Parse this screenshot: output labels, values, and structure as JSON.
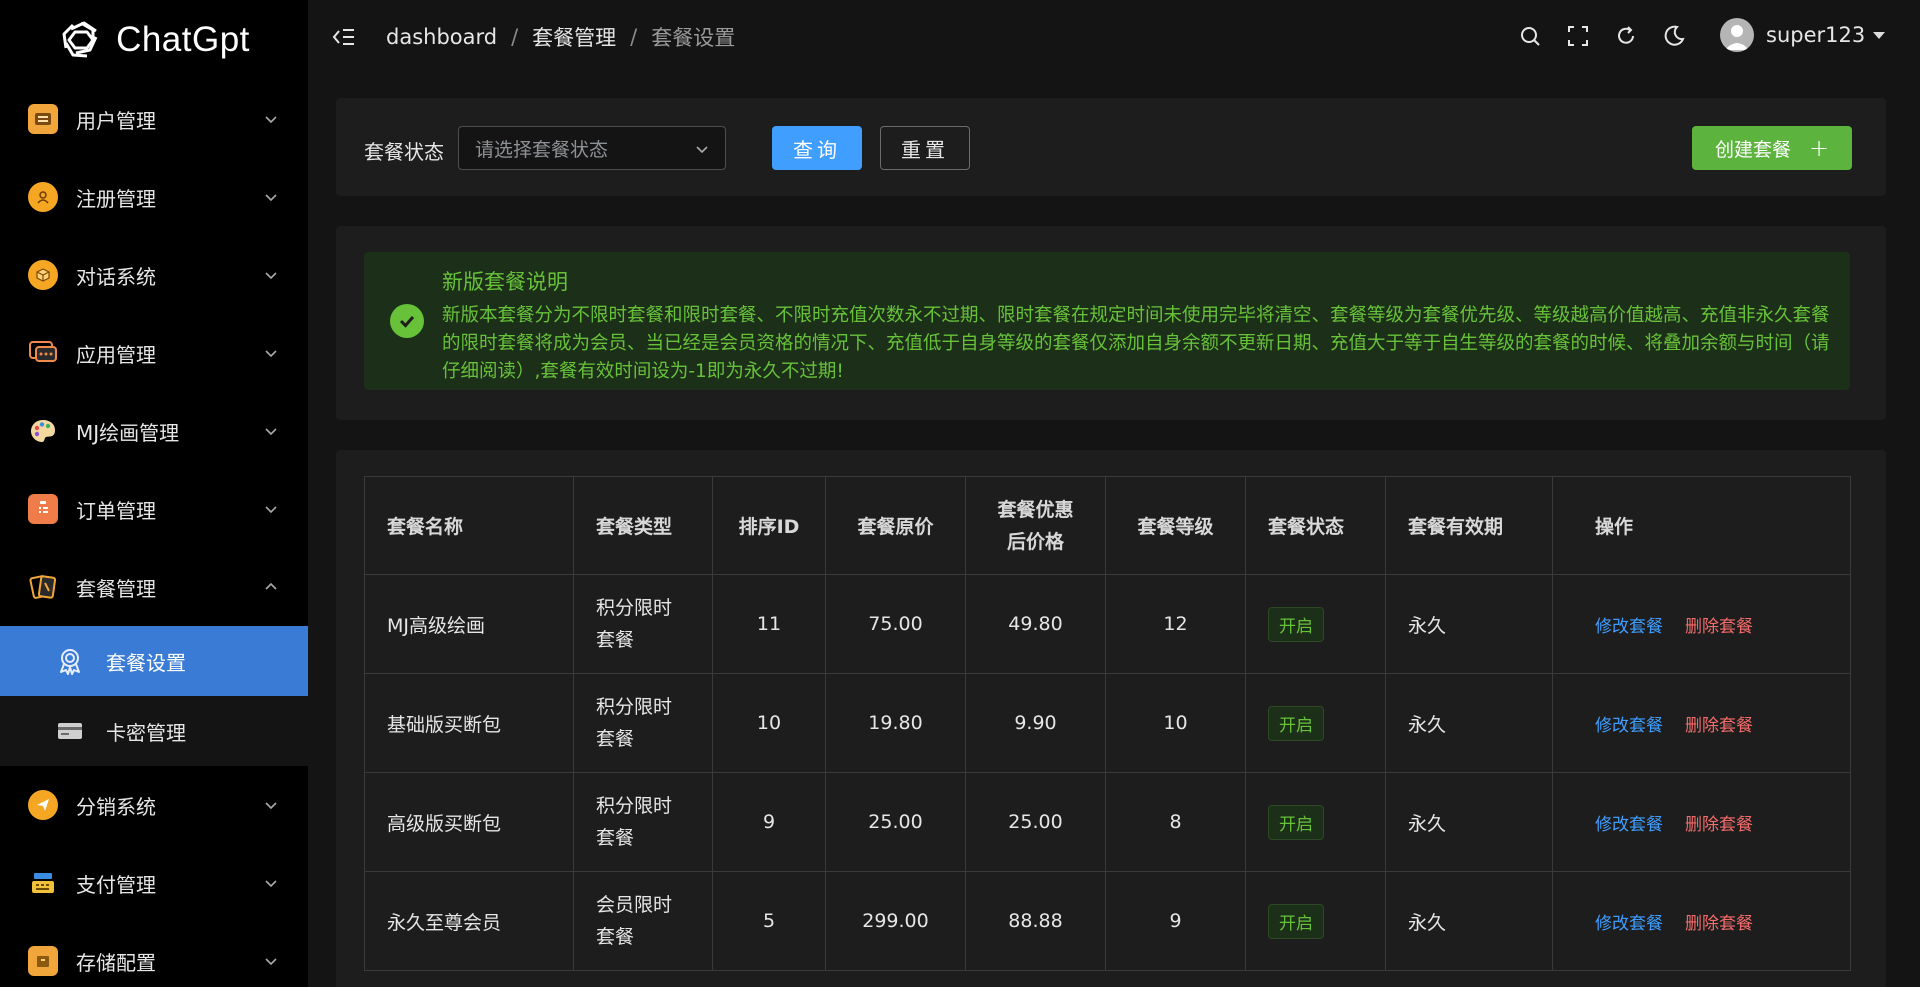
{
  "app": {
    "logo_text": "ChatGpt"
  },
  "sidebar": {
    "items": [
      {
        "label": "用户管理"
      },
      {
        "label": "注册管理"
      },
      {
        "label": "对话系统"
      },
      {
        "label": "应用管理"
      },
      {
        "label": "MJ绘画管理"
      },
      {
        "label": "订单管理"
      },
      {
        "label": "套餐管理"
      },
      {
        "label": "分销系统"
      },
      {
        "label": "支付管理"
      },
      {
        "label": "存储配置"
      }
    ],
    "submenu": [
      {
        "label": "套餐设置"
      },
      {
        "label": "卡密管理"
      }
    ]
  },
  "header": {
    "breadcrumb": [
      "dashboard",
      "套餐管理",
      "套餐设置"
    ],
    "separator": "/",
    "username": "super123"
  },
  "filter": {
    "status_label": "套餐状态",
    "status_placeholder": "请选择套餐状态",
    "query_label": "查询",
    "reset_label": "重置",
    "create_label": "创建套餐",
    "create_plus": "+"
  },
  "notice": {
    "title": "新版套餐说明",
    "description": "新版本套餐分为不限时套餐和限时套餐、不限时充值次数永不过期、限时套餐在规定时间未使用完毕将清空、套餐等级为套餐优先级、等级越高价值越高、充值非永久套餐的限时套餐将成为会员、当已经是会员资格的情况下、充值低于自身等级的套餐仅添加自身余额不更新日期、充值大于等于自生等级的套餐的时候、将叠加余额与时间（请仔细阅读）,套餐有效时间设为-1即为永久不过期!"
  },
  "table": {
    "headers": {
      "name": "套餐名称",
      "type": "套餐类型",
      "sort_id": "排序ID",
      "price": "套餐原价",
      "discount_1": "套餐优惠",
      "discount_2": "后价格",
      "level": "套餐等级",
      "status": "套餐状态",
      "validity": "套餐有效期",
      "actions": "操作"
    },
    "rows": [
      {
        "name": "MJ高级绘画",
        "type_1": "积分限时",
        "type_2": "套餐",
        "sort_id": "11",
        "price": "75.00",
        "discount": "49.80",
        "level": "12",
        "status": "开启",
        "validity": "永久",
        "edit": "修改套餐",
        "delete": "删除套餐"
      },
      {
        "name": "基础版买断包",
        "type_1": "积分限时",
        "type_2": "套餐",
        "sort_id": "10",
        "price": "19.80",
        "discount": "9.90",
        "level": "10",
        "status": "开启",
        "validity": "永久",
        "edit": "修改套餐",
        "delete": "删除套餐"
      },
      {
        "name": "高级版买断包",
        "type_1": "积分限时",
        "type_2": "套餐",
        "sort_id": "9",
        "price": "25.00",
        "discount": "25.00",
        "level": "8",
        "status": "开启",
        "validity": "永久",
        "edit": "修改套餐",
        "delete": "删除套餐"
      },
      {
        "name": "永久至尊会员",
        "type_1": "会员限时",
        "type_2": "套餐",
        "sort_id": "5",
        "price": "299.00",
        "discount": "88.88",
        "level": "9",
        "status": "开启",
        "validity": "永久",
        "edit": "修改套餐",
        "delete": "删除套餐"
      }
    ]
  },
  "colors": {
    "primary": "#409eff",
    "success": "#67c23a",
    "danger": "#f56c6c",
    "active_menu": "#3a7bd5",
    "create_button": "#5cb43f"
  }
}
